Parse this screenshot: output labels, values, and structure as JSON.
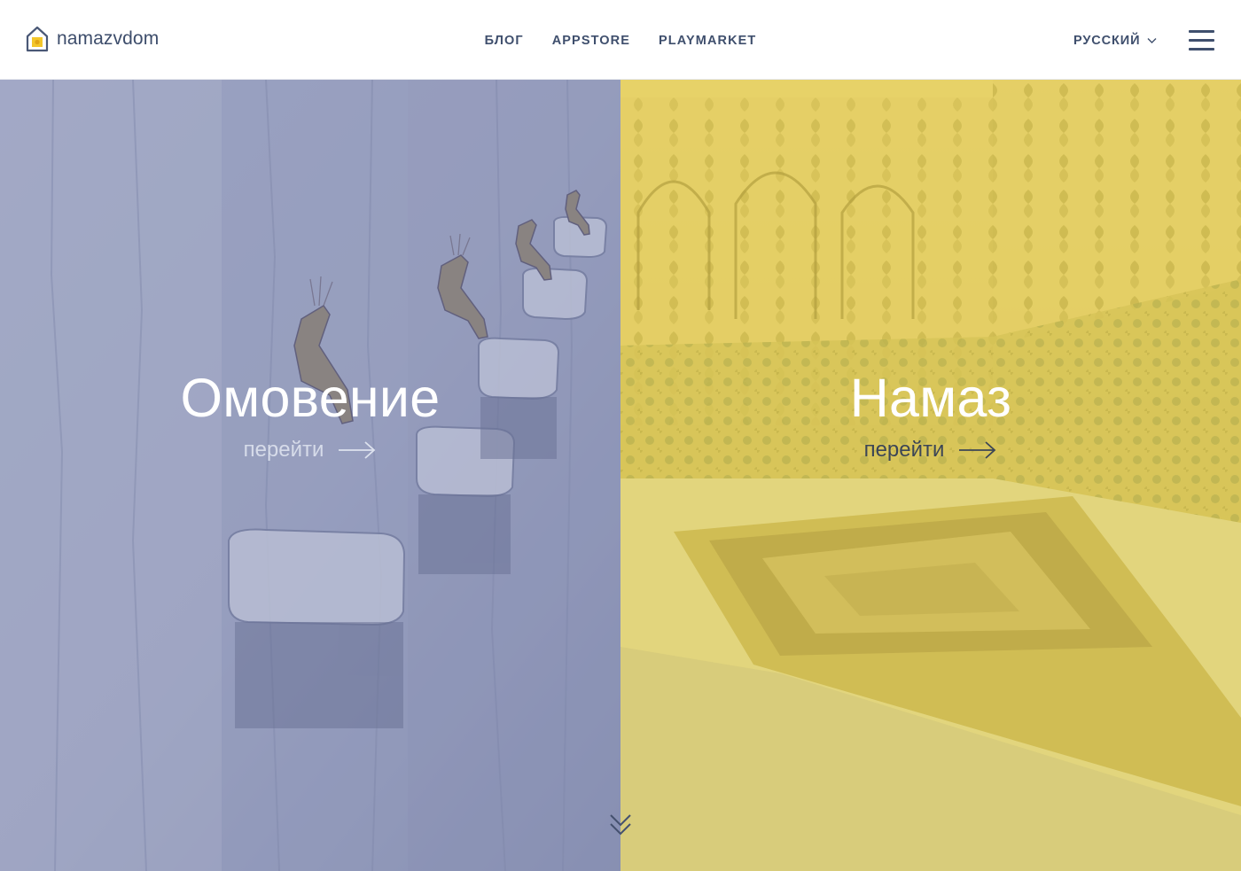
{
  "header": {
    "logo": {
      "text": "namazvdom",
      "icon": "house-logo-icon"
    },
    "nav": [
      {
        "label": "БЛОГ"
      },
      {
        "label": "APPSTORE"
      },
      {
        "label": "PLAYMARKET"
      }
    ],
    "language": {
      "selected": "РУССКИЙ",
      "icon": "chevron-down-icon"
    },
    "menu": {
      "icon": "hamburger-menu-icon"
    }
  },
  "panels": {
    "left": {
      "title": "Омовение",
      "link_label": "перейти",
      "link_icon": "arrow-right-icon",
      "overlay_color": "#8790b8"
    },
    "right": {
      "title": "Намаз",
      "link_label": "перейти",
      "link_icon": "arrow-right-icon",
      "overlay_color": "#e3cc4f"
    }
  },
  "scroll": {
    "icon": "double-chevron-down-icon"
  },
  "colors": {
    "text_dark": "#3f4f6d",
    "logo_accent": "#f3c62a"
  }
}
